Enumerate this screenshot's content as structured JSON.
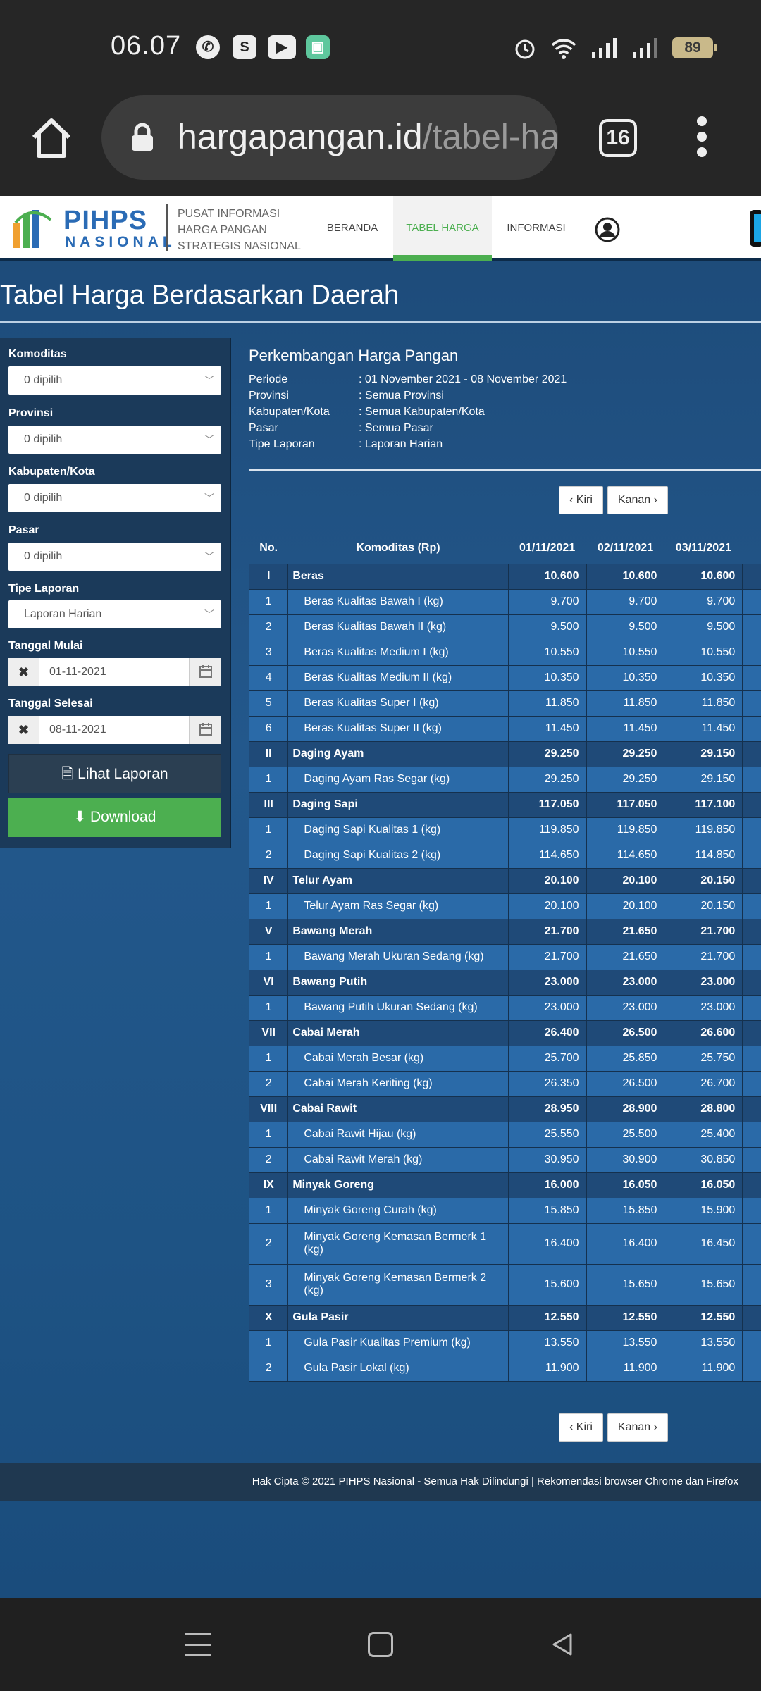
{
  "status": {
    "time": "06.07",
    "battery": "89",
    "app_icons": [
      "whatsapp-icon",
      "shopee-icon",
      "youtube-icon",
      "app-icon"
    ]
  },
  "browser": {
    "domain": "hargapangan.id",
    "path": "/tabel-ha",
    "tab_count": "16"
  },
  "header": {
    "logo_main": "PIHPS",
    "logo_sub": "NASIONAL",
    "desc": [
      "PUSAT INFORMASI",
      "HARGA PANGAN",
      "STRATEGIS NASIONAL"
    ],
    "nav": [
      "BERANDA",
      "TABEL HARGA",
      "INFORMASI"
    ]
  },
  "page_title": "Tabel Harga Berdasarkan Daerah",
  "filters": {
    "komoditas_label": "Komoditas",
    "komoditas_value": "0 dipilih",
    "provinsi_label": "Provinsi",
    "provinsi_value": "0 dipilih",
    "kabupaten_label": "Kabupaten/Kota",
    "kabupaten_value": "0 dipilih",
    "pasar_label": "Pasar",
    "pasar_value": "0 dipilih",
    "tipe_label": "Tipe Laporan",
    "tipe_value": "Laporan Harian",
    "mulai_label": "Tanggal Mulai",
    "mulai_value": "01-11-2021",
    "selesai_label": "Tanggal Selesai",
    "selesai_value": "08-11-2021",
    "lihat_label": "Lihat Laporan",
    "download_label": "Download"
  },
  "report": {
    "title": "Perkembangan Harga Pangan",
    "info": [
      {
        "key": "Periode",
        "value": ": 01 November 2021 - 08 November 2021"
      },
      {
        "key": "Provinsi",
        "value": ": Semua Provinsi"
      },
      {
        "key": "Kabupaten/Kota",
        "value": ": Semua Kabupaten/Kota"
      },
      {
        "key": "Pasar",
        "value": ": Semua Pasar"
      },
      {
        "key": "Tipe Laporan",
        "value": ": Laporan Harian"
      }
    ],
    "prev_label": "Kiri",
    "next_label": "Kanan"
  },
  "table": {
    "headers": [
      "No.",
      "Komoditas (Rp)",
      "01/11/2021",
      "02/11/2021",
      "03/11/2021"
    ],
    "rows": [
      {
        "type": "grp",
        "no": "I",
        "name": "Beras",
        "v": [
          "10.600",
          "10.600",
          "10.600"
        ]
      },
      {
        "type": "item",
        "no": "1",
        "name": "Beras Kualitas Bawah I (kg)",
        "v": [
          "9.700",
          "9.700",
          "9.700"
        ]
      },
      {
        "type": "item",
        "no": "2",
        "name": "Beras Kualitas Bawah II (kg)",
        "v": [
          "9.500",
          "9.500",
          "9.500"
        ]
      },
      {
        "type": "item",
        "no": "3",
        "name": "Beras Kualitas Medium I (kg)",
        "v": [
          "10.550",
          "10.550",
          "10.550"
        ]
      },
      {
        "type": "item",
        "no": "4",
        "name": "Beras Kualitas Medium II (kg)",
        "v": [
          "10.350",
          "10.350",
          "10.350"
        ]
      },
      {
        "type": "item",
        "no": "5",
        "name": "Beras Kualitas Super I (kg)",
        "v": [
          "11.850",
          "11.850",
          "11.850"
        ]
      },
      {
        "type": "item",
        "no": "6",
        "name": "Beras Kualitas Super II (kg)",
        "v": [
          "11.450",
          "11.450",
          "11.450"
        ]
      },
      {
        "type": "grp",
        "no": "II",
        "name": "Daging Ayam",
        "v": [
          "29.250",
          "29.250",
          "29.150"
        ]
      },
      {
        "type": "item",
        "no": "1",
        "name": "Daging Ayam Ras Segar (kg)",
        "v": [
          "29.250",
          "29.250",
          "29.150"
        ]
      },
      {
        "type": "grp",
        "no": "III",
        "name": "Daging Sapi",
        "v": [
          "117.050",
          "117.050",
          "117.100"
        ]
      },
      {
        "type": "item",
        "no": "1",
        "name": "Daging Sapi Kualitas 1 (kg)",
        "v": [
          "119.850",
          "119.850",
          "119.850"
        ]
      },
      {
        "type": "item",
        "no": "2",
        "name": "Daging Sapi Kualitas 2 (kg)",
        "v": [
          "114.650",
          "114.650",
          "114.850"
        ]
      },
      {
        "type": "grp",
        "no": "IV",
        "name": "Telur Ayam",
        "v": [
          "20.100",
          "20.100",
          "20.150"
        ]
      },
      {
        "type": "item",
        "no": "1",
        "name": "Telur Ayam Ras Segar (kg)",
        "v": [
          "20.100",
          "20.100",
          "20.150"
        ]
      },
      {
        "type": "grp",
        "no": "V",
        "name": "Bawang Merah",
        "v": [
          "21.700",
          "21.650",
          "21.700"
        ]
      },
      {
        "type": "item",
        "no": "1",
        "name": "Bawang Merah Ukuran Sedang (kg)",
        "v": [
          "21.700",
          "21.650",
          "21.700"
        ]
      },
      {
        "type": "grp",
        "no": "VI",
        "name": "Bawang Putih",
        "v": [
          "23.000",
          "23.000",
          "23.000"
        ]
      },
      {
        "type": "item",
        "no": "1",
        "name": "Bawang Putih Ukuran Sedang (kg)",
        "v": [
          "23.000",
          "23.000",
          "23.000"
        ]
      },
      {
        "type": "grp",
        "no": "VII",
        "name": "Cabai Merah",
        "v": [
          "26.400",
          "26.500",
          "26.600"
        ]
      },
      {
        "type": "item",
        "no": "1",
        "name": "Cabai Merah Besar (kg)",
        "v": [
          "25.700",
          "25.850",
          "25.750"
        ]
      },
      {
        "type": "item",
        "no": "2",
        "name": "Cabai Merah Keriting (kg)",
        "v": [
          "26.350",
          "26.500",
          "26.700"
        ]
      },
      {
        "type": "grp",
        "no": "VIII",
        "name": "Cabai Rawit",
        "v": [
          "28.950",
          "28.900",
          "28.800"
        ]
      },
      {
        "type": "item",
        "no": "1",
        "name": "Cabai Rawit Hijau (kg)",
        "v": [
          "25.550",
          "25.500",
          "25.400"
        ]
      },
      {
        "type": "item",
        "no": "2",
        "name": "Cabai Rawit Merah (kg)",
        "v": [
          "30.950",
          "30.900",
          "30.850"
        ]
      },
      {
        "type": "grp",
        "no": "IX",
        "name": "Minyak Goreng",
        "v": [
          "16.000",
          "16.050",
          "16.050"
        ]
      },
      {
        "type": "item",
        "no": "1",
        "name": "Minyak Goreng Curah (kg)",
        "v": [
          "15.850",
          "15.850",
          "15.900"
        ]
      },
      {
        "type": "item",
        "no": "2",
        "name": "Minyak Goreng Kemasan Bermerk 1 (kg)",
        "v": [
          "16.400",
          "16.400",
          "16.450"
        ],
        "tall": true
      },
      {
        "type": "item",
        "no": "3",
        "name": "Minyak Goreng Kemasan Bermerk 2 (kg)",
        "v": [
          "15.600",
          "15.650",
          "15.650"
        ],
        "tall": true
      },
      {
        "type": "grp",
        "no": "X",
        "name": "Gula Pasir",
        "v": [
          "12.550",
          "12.550",
          "12.550"
        ]
      },
      {
        "type": "item",
        "no": "1",
        "name": "Gula Pasir Kualitas Premium (kg)",
        "v": [
          "13.550",
          "13.550",
          "13.550"
        ]
      },
      {
        "type": "item",
        "no": "2",
        "name": "Gula Pasir Lokal (kg)",
        "v": [
          "11.900",
          "11.900",
          "11.900"
        ]
      }
    ]
  },
  "footer": "Hak Cipta © 2021 PIHPS Nasional - Semua Hak Dilindungi  |  Rekomendasi browser Chrome dan Firefox",
  "colors": {
    "accent_green": "#4caf50",
    "brand_blue": "#2a6bb5",
    "page_bg": "#1f5183",
    "group_row": "#1f4a78",
    "item_row": "#2a6aa8"
  }
}
